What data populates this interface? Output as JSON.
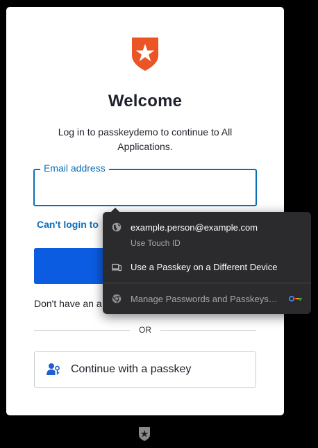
{
  "login": {
    "title": "Welcome",
    "subtitle": "Log in to passkeydemo to continue to All Applications.",
    "email_label": "Email address",
    "email_value": "",
    "cant_login": "Can't login to",
    "signup_prefix": "Don't have an a",
    "or": "OR",
    "passkey_button": "Continue with a passkey"
  },
  "autofill": {
    "account_email": "example.person@example.com",
    "account_sub": "Use Touch ID",
    "other_device": "Use a Passkey on a Different Device",
    "manage": "Manage Passwords and Passkeys…"
  },
  "colors": {
    "brand": "#eb5424",
    "accent": "#0a6fb7",
    "primary_button": "#0b5ce1",
    "popup_bg": "#2b2b2d"
  },
  "icons": {
    "logo": "auth0-shield-star-icon",
    "passkey": "user-key-icon",
    "account": "globe-icon",
    "device": "devices-icon",
    "manage": "chrome-icon",
    "password_manager": "key-icon",
    "footer": "auth0-badge-icon"
  }
}
